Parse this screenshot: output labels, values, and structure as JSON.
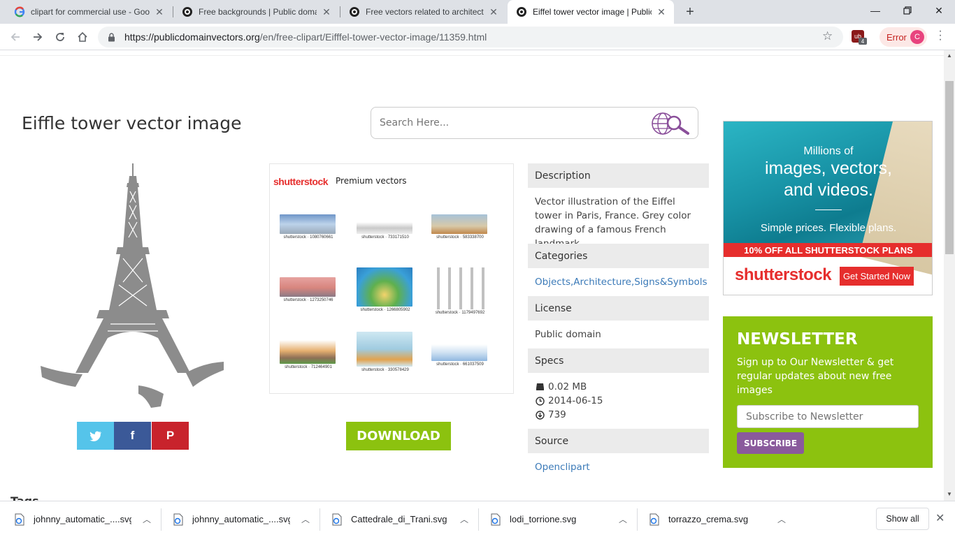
{
  "browser": {
    "tabs": [
      {
        "title": "clipart for commercial use - Goog",
        "favicon": "google-icon",
        "active": false
      },
      {
        "title": "Free backgrounds | Public domai",
        "favicon": "pdv-icon",
        "active": false
      },
      {
        "title": "Free vectors related to architectu",
        "favicon": "pdv-icon",
        "active": false
      },
      {
        "title": "Eiffel tower vector image | Public",
        "favicon": "pdv-icon",
        "active": true
      }
    ],
    "url_host": "https://publicdomainvectors.org",
    "url_path": "/en/free-clipart/Eifffel-tower-vector-image/11359.html",
    "error_label": "Error",
    "avatar_letter": "C",
    "ext_badge": "4",
    "ext_label": "ub"
  },
  "page": {
    "title": "Eiffle tower vector image",
    "search_placeholder": "Search Here...",
    "download_label": "DOWNLOAD",
    "tags_peek": "Tags"
  },
  "premium": {
    "brand": "shutterstock",
    "label": "Premium vectors",
    "items": [
      {
        "caption": "shutterstock · 1080760661"
      },
      {
        "caption": "shutterstock · 733171510"
      },
      {
        "caption": "shutterstock · 583338700"
      },
      {
        "caption": "shutterstock · 1273250746"
      },
      {
        "caption": "shutterstock · 1266805902"
      },
      {
        "caption": "shutterstock · 1179497692"
      },
      {
        "caption": "shutterstock · 712464901"
      },
      {
        "caption": "shutterstock · 330578429"
      },
      {
        "caption": "shutterstock · 661037509"
      }
    ]
  },
  "info": {
    "description_head": "Description",
    "description": "Vector illustration of the Eiffel tower in Paris, France. Grey color drawing of a famous French landmark.",
    "categories_head": "Categories",
    "categories": "Objects,Architecture,Signs&Symbols",
    "license_head": "License",
    "license": "Public domain",
    "specs_head": "Specs",
    "size": "0.02 MB",
    "date": "2014-06-15",
    "downloads": "739",
    "source_head": "Source",
    "source": "Openclipart"
  },
  "ad": {
    "line1": "Millions of",
    "line2": "images, vectors,",
    "line3": "and videos.",
    "line4": "Simple prices. Flexible plans.",
    "band": "10% OFF ALL SHUTTERSTOCK PLANS",
    "logo": "shutterstock",
    "cta": "Get Started Now"
  },
  "newsletter": {
    "heading": "NEWSLETTER",
    "text": "Sign up to Our Newsletter & get regular updates about new free images",
    "placeholder": "Subscribe to Newsletter",
    "button": "SUBSCRIBE"
  },
  "downloads": [
    {
      "name": "johnny_automatic_....svg"
    },
    {
      "name": "johnny_automatic_....svg"
    },
    {
      "name": "Cattedrale_di_Trani.svg"
    },
    {
      "name": "lodi_torrione.svg"
    },
    {
      "name": "torrazzo_crema.svg"
    }
  ],
  "shelf": {
    "show_all": "Show all"
  },
  "colors": {
    "accent_green": "#8cc20f",
    "shutterstock_red": "#e62e2d",
    "twitter": "#55c4ea",
    "facebook": "#3b5998",
    "pinterest": "#c8232c",
    "link": "#3b7ab8"
  }
}
